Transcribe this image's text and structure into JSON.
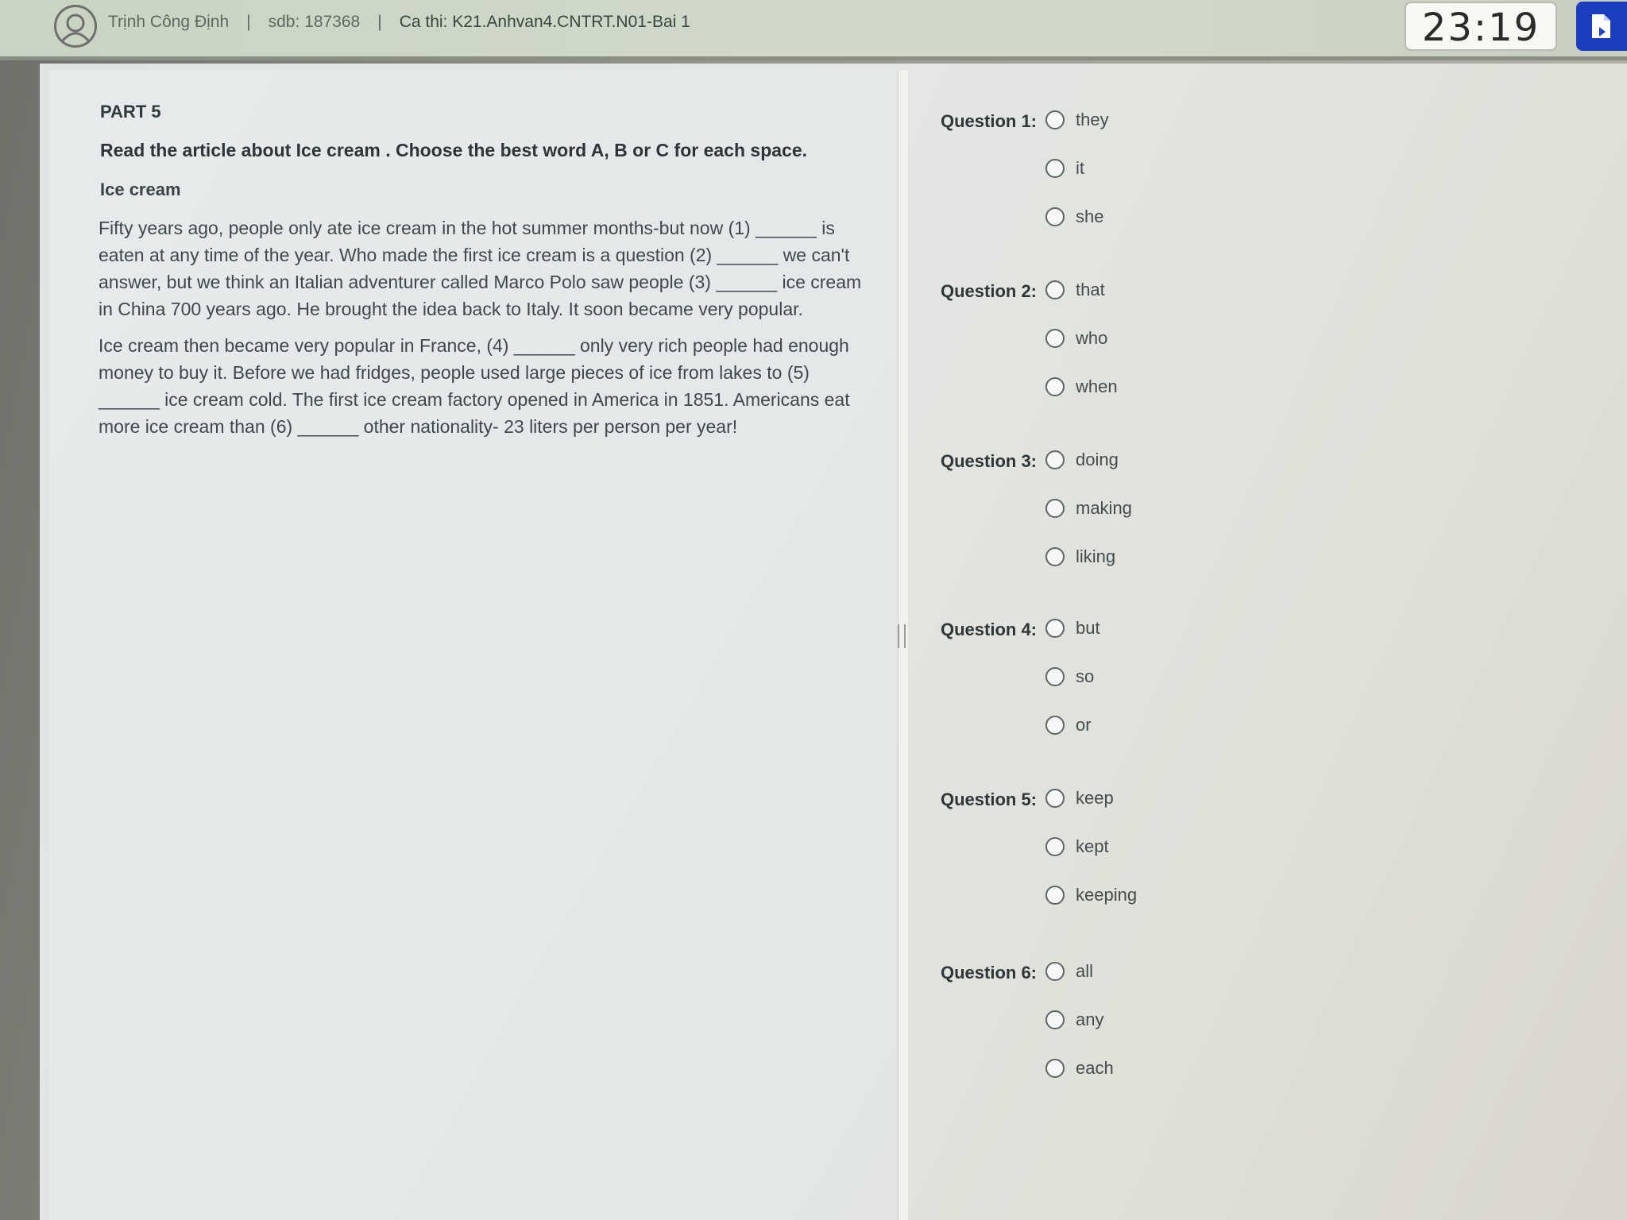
{
  "header": {
    "user_name": "Trịnh Công Định",
    "separator": "|",
    "sdb": "sdb: 187368",
    "exam": "Ca thi: K21.Anhvan4.CNTRT.N01-Bai 1",
    "timer": "23:19",
    "avatar_icon": "user-avatar-icon",
    "submit_icon": "submit-document-icon",
    "submit_color": "#1c3dbf"
  },
  "passage": {
    "part_title": "PART 5",
    "instruction": "Read the article about Ice cream . Choose the best word A, B or C for each space.",
    "article_title": "Ice cream",
    "paragraph1": [
      "Fifty years ago, people only ate ice cream in the hot summer months-but now (1) ______ is",
      "eaten at any time of the year. Who made the first ice cream is a question (2) ______ we can't",
      "answer, but we think an Italian adventurer called Marco Polo saw people (3) ______ ice cream",
      "in China 700 years ago. He brought the idea back to Italy. It soon became very popular."
    ],
    "paragraph2": [
      "Ice cream then became very popular in France, (4) ______ only very rich people had enough",
      "money to buy it. Before we had fridges, people used large pieces of ice from lakes to (5)",
      "______ ice cream cold. The first ice cream factory opened in America in 1851. Americans eat",
      "more ice cream than (6) ______ other nationality- 23 liters per person per year!"
    ]
  },
  "questions": [
    {
      "label": "Question 1:",
      "options": [
        "they",
        "it",
        "she"
      ]
    },
    {
      "label": "Question 2:",
      "options": [
        "that",
        "who",
        "when"
      ]
    },
    {
      "label": "Question 3:",
      "options": [
        "doing",
        "making",
        "liking"
      ]
    },
    {
      "label": "Question 4:",
      "options": [
        "but",
        "so",
        "or"
      ]
    },
    {
      "label": "Question 5:",
      "options": [
        "keep",
        "kept",
        "keeping"
      ]
    },
    {
      "label": "Question 6:",
      "options": [
        "all",
        "any",
        "each"
      ]
    }
  ]
}
